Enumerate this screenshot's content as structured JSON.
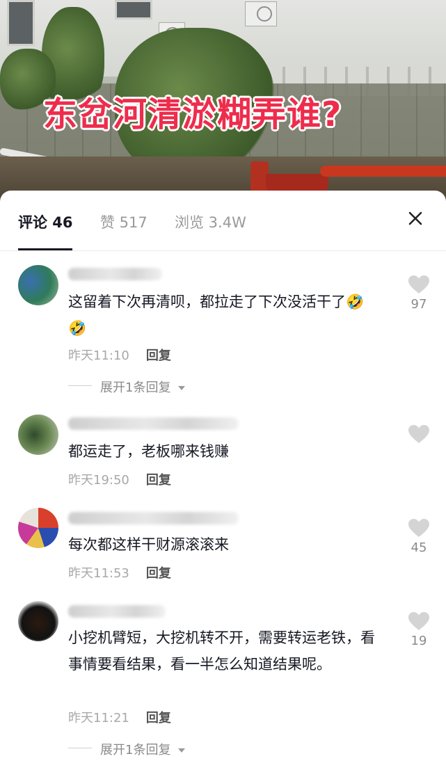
{
  "video": {
    "title_overlay": "东岔河清淤糊弄谁?"
  },
  "tabs": [
    {
      "label": "评论 46"
    },
    {
      "label": "赞 517"
    },
    {
      "label": "浏览 3.4W"
    }
  ],
  "comments": [
    {
      "text": "这留着下次再清呗，都拉走了下次没活干了🤣🤣",
      "time": "昨天11:10",
      "reply": "回复",
      "likes": "97",
      "expand": "展开1条回复"
    },
    {
      "text": "都运走了，老板哪来钱赚",
      "time": "昨天19:50",
      "reply": "回复",
      "likes": ""
    },
    {
      "text": "每次都这样干财源滚滚来",
      "time": "昨天11:53",
      "reply": "回复",
      "likes": "45"
    },
    {
      "text": "小挖机臂短，大挖机转不开，需要转运老铁，看事情要看结果，看一半怎么知道结果呢。",
      "time": "昨天11:21",
      "reply": "回复",
      "likes": "19",
      "expand": "展开1条回复"
    }
  ],
  "icons": {
    "close": "close-icon",
    "like": "heart-icon",
    "expand": "caret-down-icon"
  },
  "colors": {
    "title_red": "#ee2c4c",
    "text_dark": "#161823",
    "muted": "#a8a8a8",
    "heart": "#d4d4d4"
  }
}
